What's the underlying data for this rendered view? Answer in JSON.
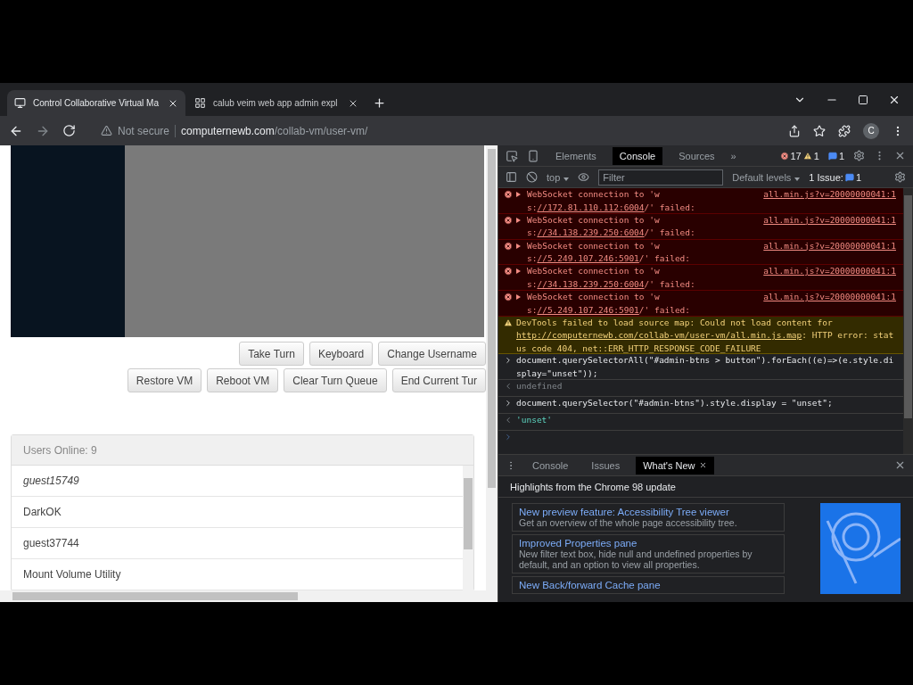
{
  "browser": {
    "tabs": [
      {
        "title": "Control Collaborative Virtual Ma",
        "selected": true
      },
      {
        "title": "calub veim web app admin expl",
        "selected": false
      }
    ],
    "address": {
      "security": "Not secure",
      "host": "computernewb.com",
      "path": "/collab-vm/user-vm/"
    },
    "avatar": "C"
  },
  "page": {
    "button_rows": [
      [
        "Take Turn",
        "Keyboard",
        "Change Username"
      ],
      [
        "Restore VM",
        "Reboot VM",
        "Clear Turn Queue",
        "End Current Tur"
      ]
    ],
    "users": {
      "header": "Users Online: 9",
      "items": [
        {
          "name": "guest15749",
          "current": true
        },
        {
          "name": "DarkOK",
          "current": false
        },
        {
          "name": "guest37744",
          "current": false
        },
        {
          "name": "Mount Volume Utility",
          "current": false
        }
      ]
    }
  },
  "devtools": {
    "tabs": [
      {
        "label": "Elements",
        "selected": false
      },
      {
        "label": "Console",
        "selected": true
      },
      {
        "label": "Sources",
        "selected": false
      }
    ],
    "more": "»",
    "error_count": "17",
    "warning_count": "1",
    "message_count": "1",
    "context": "top",
    "filter_placeholder": "Filter",
    "levels": "Default levels",
    "issues_label": "1 Issue:",
    "issues_count": "1",
    "console": [
      {
        "kind": "error",
        "text": "WebSocket connection to 'ws:",
        "url": "//172.81.110.112:6004",
        "tail": "/' failed:",
        "source": "all.min.js?v=20000000041:1"
      },
      {
        "kind": "error",
        "text": "WebSocket connection to 'ws:",
        "url": "//34.138.239.250:6004",
        "tail": "/' failed:",
        "source": "all.min.js?v=20000000041:1"
      },
      {
        "kind": "error",
        "text": "WebSocket connection to 'ws:",
        "url": "//5.249.107.246:5901",
        "tail": "/' failed:",
        "source": "all.min.js?v=20000000041:1"
      },
      {
        "kind": "error",
        "text": "WebSocket connection to 'ws:",
        "url": "//34.138.239.250:6004",
        "tail": "/' failed:",
        "source": "all.min.js?v=20000000041:1"
      },
      {
        "kind": "error",
        "text": "WebSocket connection to 'ws:",
        "url": "//5.249.107.246:5901",
        "tail": "/' failed:",
        "source": "all.min.js?v=20000000041:1"
      },
      {
        "kind": "warning",
        "text": "DevTools failed to load source map: Could not load content for ",
        "url": "http://computernewb.com/collab-vm/user-vm/all.min.js.map",
        "tail": ": HTTP error: status code 404, net::ERR_HTTP_RESPONSE_CODE_FAILURE"
      },
      {
        "kind": "input",
        "text": "document.querySelectorAll(\"#admin-btns > button\").forEach((e)=>(e.style.display=\"unset\"));"
      },
      {
        "kind": "void",
        "text": "undefined"
      },
      {
        "kind": "input",
        "text": "document.querySelector(\"#admin-btns\").style.display = \"unset\";"
      },
      {
        "kind": "result",
        "text": "'unset'"
      },
      {
        "kind": "prompt"
      }
    ],
    "drawer": {
      "tabs": [
        {
          "label": "Console",
          "selected": false,
          "closable": false
        },
        {
          "label": "Issues",
          "selected": false,
          "closable": false
        },
        {
          "label": "What's New",
          "selected": true,
          "closable": true
        }
      ],
      "heading": "Highlights from the Chrome 98 update",
      "cards": [
        {
          "title": "New preview feature: Accessibility Tree viewer",
          "text": "Get an overview of the whole page accessibility tree."
        },
        {
          "title": "Improved Properties pane",
          "text": "New filter text box, hide null and undefined properties by default, and an option to view all properties."
        },
        {
          "title": "New Back/forward Cache pane"
        }
      ]
    }
  }
}
